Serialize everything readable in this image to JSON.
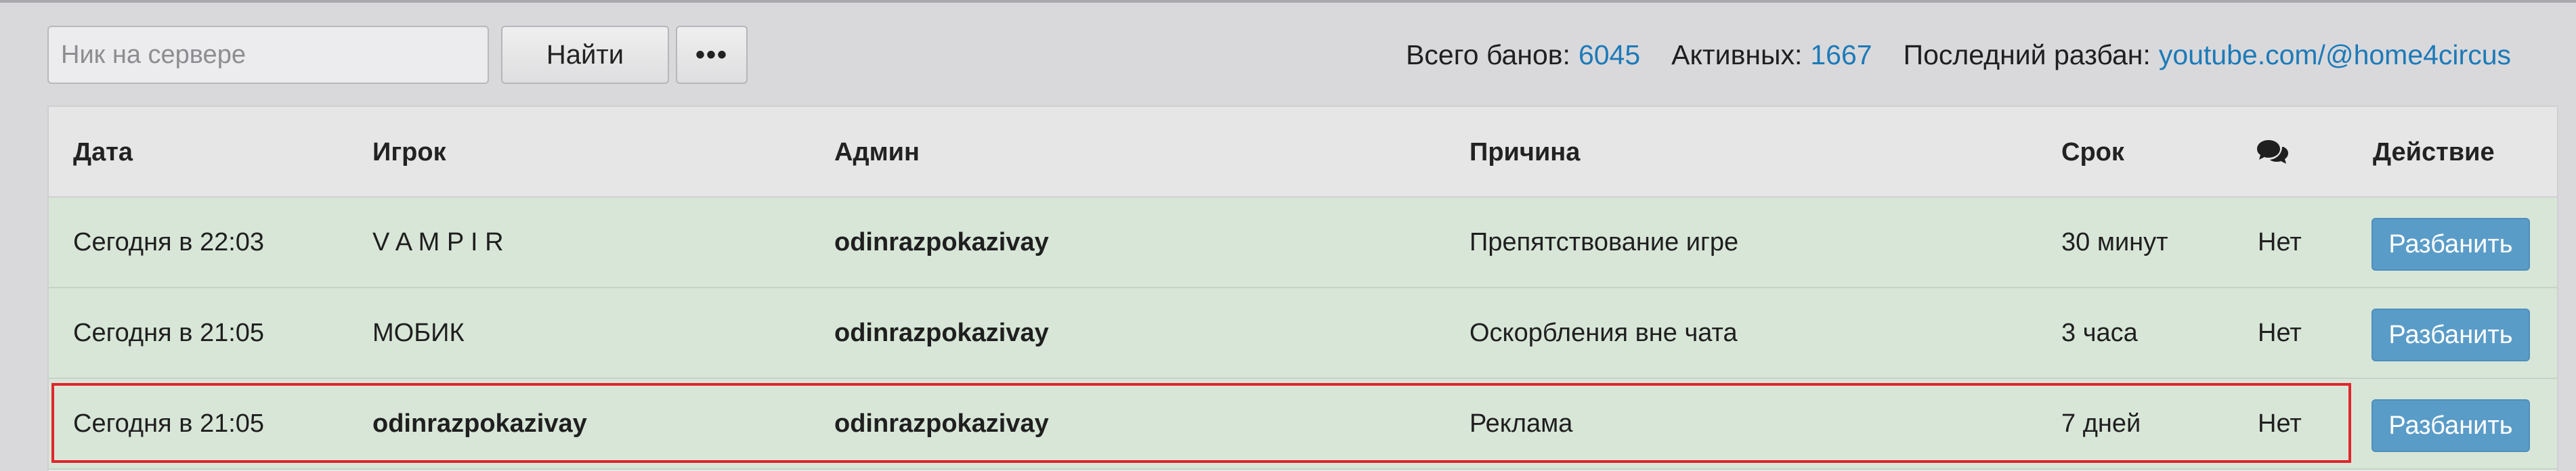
{
  "search": {
    "placeholder": "Ник на сервере",
    "find_label": "Найти",
    "more_label": "•••"
  },
  "stats": {
    "total_label": "Всего банов:",
    "total_value": "6045",
    "active_label": "Активных:",
    "active_value": "1667",
    "last_unban_label": "Последний разбан:",
    "last_unban_value": "youtube.com/@home4circus"
  },
  "table": {
    "headers": {
      "date": "Дата",
      "player": "Игрок",
      "admin": "Админ",
      "reason": "Причина",
      "term": "Срок",
      "comments_icon": "comments-icon",
      "action": "Действие"
    },
    "rows": [
      {
        "date": "Сегодня в 22:03",
        "player": "V A M P I R",
        "admin": "odinrazpokazivay",
        "reason": "Препятствование игре",
        "term": "30 минут",
        "comments": "Нет",
        "action": "Разбанить"
      },
      {
        "date": "Сегодня в 21:05",
        "player": "МОБИК",
        "admin": "odinrazpokazivay",
        "reason": "Оскорбления вне чата",
        "term": "3 часа",
        "comments": "Нет",
        "action": "Разбанить"
      },
      {
        "date": "Сегодня в 21:05",
        "player": "odinrazpokazivay",
        "admin": "odinrazpokazivay",
        "reason": "Реклама",
        "term": "7 дней",
        "comments": "Нет",
        "action": "Разбанить"
      }
    ]
  },
  "colors": {
    "link": "#1d7ab8",
    "row_bg": "#d8e6d8",
    "button_primary": "#5a9cc8",
    "highlight": "#e1262c"
  }
}
